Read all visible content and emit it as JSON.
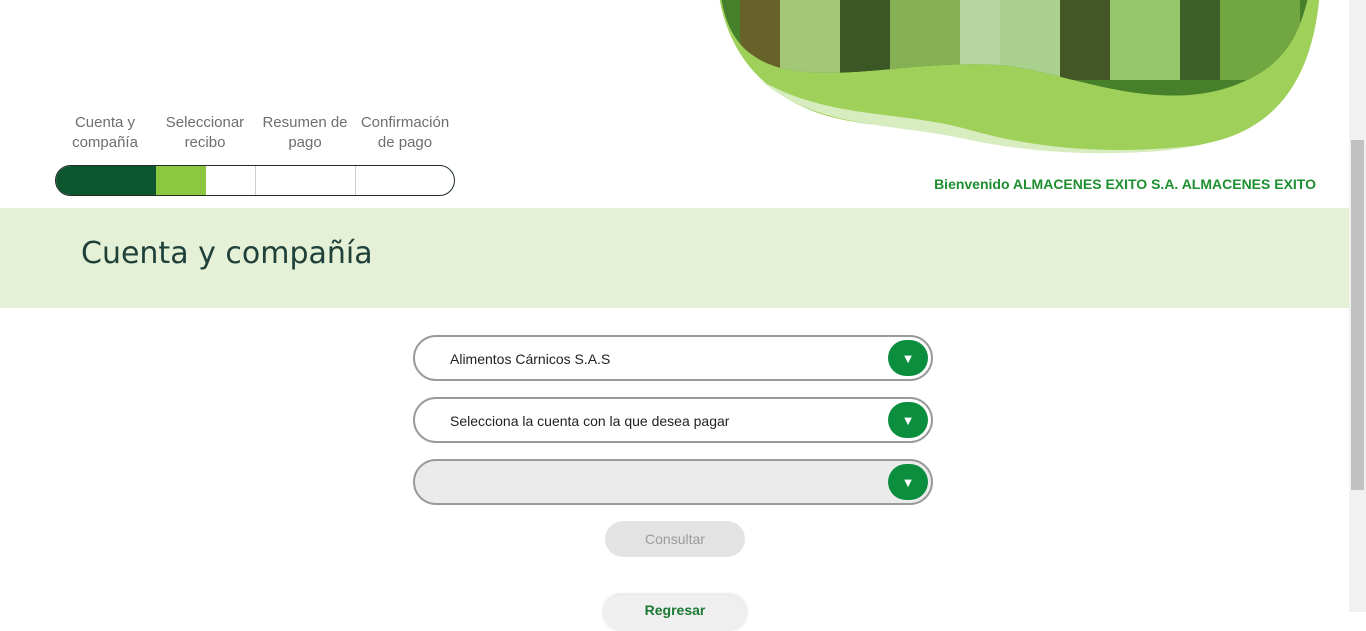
{
  "header": {
    "welcome_text": "Bienvenido ALMACENES EXITO S.A. ALMACENES EXITO"
  },
  "steps": [
    {
      "label_line1": "Cuenta y",
      "label_line2": "compañía"
    },
    {
      "label_line1": "Seleccionar",
      "label_line2": "recibo"
    },
    {
      "label_line1": "Resumen de",
      "label_line2": "pago"
    },
    {
      "label_line1": "Confirmación",
      "label_line2": "de pago"
    }
  ],
  "section": {
    "title": "Cuenta y compañía"
  },
  "form": {
    "company_select": {
      "value": "Alimentos Cárnicos S.A.S",
      "icon": "chevron-down-icon"
    },
    "account_select": {
      "value": "Selecciona la cuenta con la que desea pagar",
      "icon": "chevron-down-icon"
    },
    "third_select": {
      "value": "",
      "icon": "chevron-down-icon"
    },
    "dropdown_glyph": "▼",
    "consult_label": "Consultar",
    "back_label": "Regresar"
  },
  "colors": {
    "brand_dark_green": "#0e5630",
    "brand_light_green": "#8dc63f",
    "button_green": "#0b8f3f",
    "band_background": "#e4f1d6",
    "welcome_text": "#1d8f2f"
  }
}
